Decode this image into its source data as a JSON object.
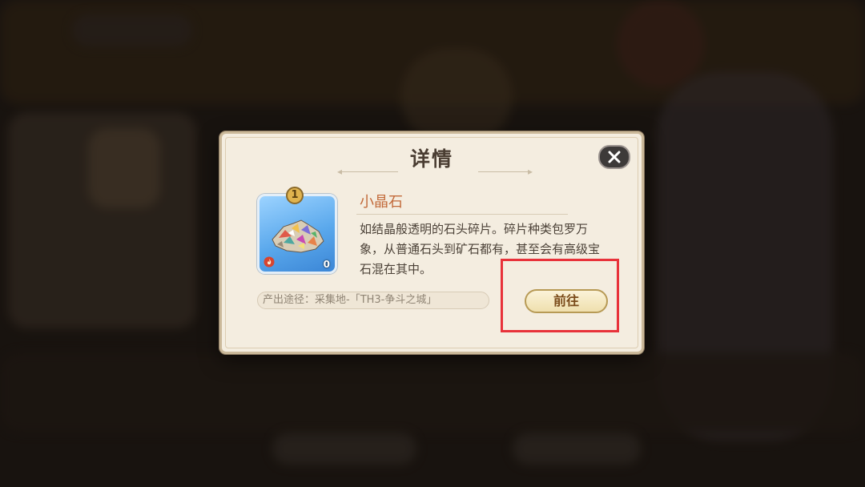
{
  "dialog": {
    "title": "详情",
    "close_icon": "close-x-icon"
  },
  "item": {
    "name": "小晶石",
    "rarity": "1",
    "count": "0",
    "description": "如结晶般透明的石头碎片。碎片种类包罗万象，从普通石头到矿石都有，甚至会有高级宝石混在其中。",
    "image_icon": "crystal-shards-icon",
    "element_icon": "fire-icon"
  },
  "source": {
    "text": "产出途径：采集地-「TH3-争斗之城」"
  },
  "actions": {
    "go_label": "前往"
  },
  "colors": {
    "panel": "#f4ede0",
    "item_name": "#c26a3a",
    "highlight": "#e8323a",
    "card": "#5aa8ec"
  }
}
